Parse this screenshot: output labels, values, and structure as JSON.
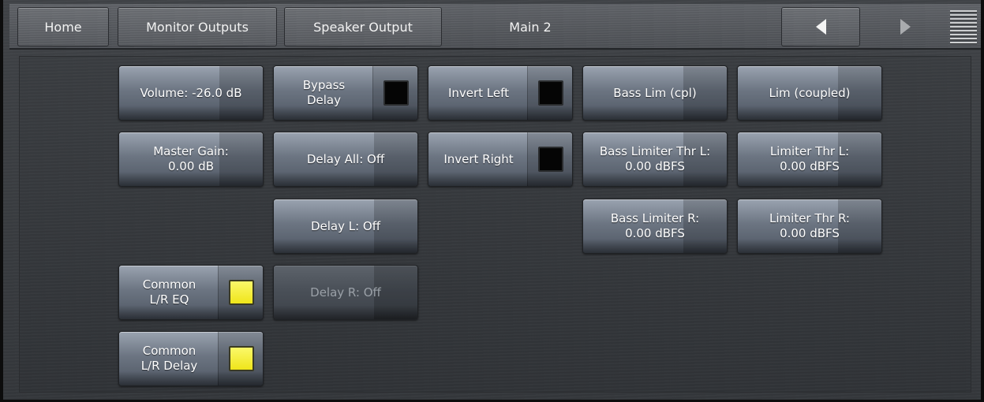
{
  "header": {
    "tabs": [
      {
        "label": "Home"
      },
      {
        "label": "Monitor Outputs"
      },
      {
        "label": "Speaker Output"
      }
    ],
    "current_page": "Main 2",
    "prev_icon": "triangle-left-icon",
    "next_icon": "triangle-right-icon",
    "menu_icon": "menu-lines-icon"
  },
  "colors": {
    "indicator_off": "#050505",
    "indicator_on": "#f2e820",
    "button_face": "#6c7582"
  },
  "controls": {
    "volume": "Volume: -26.0 dB",
    "master_gain": "Master Gain:\n0.00 dB",
    "common_lr_eq": {
      "label": "Common\nL/R EQ",
      "state": "on"
    },
    "common_lr_delay": {
      "label": "Common\nL/R Delay",
      "state": "on"
    },
    "bypass_delay": {
      "label": "Bypass\nDelay",
      "state": "off"
    },
    "delay_all": "Delay All: Off",
    "delay_l": "Delay L: Off",
    "delay_r": {
      "label": "Delay R: Off",
      "enabled": false
    },
    "invert_left": {
      "label": "Invert Left",
      "state": "off"
    },
    "invert_right": {
      "label": "Invert Right",
      "state": "off"
    },
    "bass_lim": "Bass Lim (cpl)",
    "bass_limiter_thr_l": "Bass Limiter Thr L:\n0.00 dBFS",
    "bass_limiter_r": "Bass Limiter R:\n0.00 dBFS",
    "lim": "Lim (coupled)",
    "limiter_thr_l": "Limiter Thr L:\n0.00 dBFS",
    "limiter_thr_r": "Limiter Thr R:\n0.00 dBFS"
  }
}
